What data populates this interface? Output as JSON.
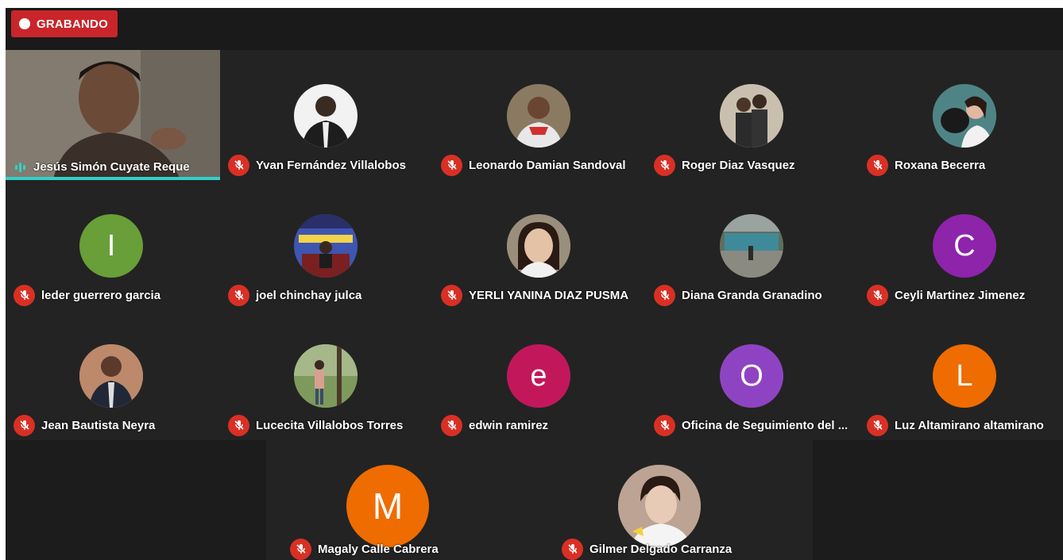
{
  "recording": {
    "label": "GRABANDO",
    "color": "#c9252b"
  },
  "colors": {
    "mic_muted": "#d93025",
    "active_speaker": "#33d0c8"
  },
  "active_speaker": {
    "name": "Jesús Simón Cuyate Reque"
  },
  "participants": [
    {
      "name": "Yvan Fernández Villalobos",
      "avatar": "photo"
    },
    {
      "name": "Leonardo Damian Sandoval",
      "avatar": "photo"
    },
    {
      "name": "Roger Diaz Vasquez",
      "avatar": "photo"
    },
    {
      "name": "Roxana Becerra",
      "avatar": "photo"
    },
    {
      "name": "leder guerrero garcia",
      "initial": "I",
      "color": "#689f38"
    },
    {
      "name": "joel chinchay julca",
      "avatar": "photo"
    },
    {
      "name": "YERLI YANINA DIAZ PUSMA",
      "avatar": "photo"
    },
    {
      "name": "Diana Granda Granadino",
      "avatar": "photo"
    },
    {
      "name": "Ceyli Martinez Jimenez",
      "initial": "C",
      "color": "#8e24aa"
    },
    {
      "name": "Jean Bautista Neyra",
      "avatar": "photo"
    },
    {
      "name": "Lucecita Villalobos Torres",
      "avatar": "photo"
    },
    {
      "name": "edwin ramirez",
      "initial": "e",
      "color": "#c2185b"
    },
    {
      "name": "Oficina de Seguimiento del ...",
      "initial": "O",
      "color": "#8e44c2"
    },
    {
      "name": "Luz Altamirano altamirano",
      "initial": "L",
      "color": "#ef6c00"
    },
    {
      "name": "Magaly Calle Cabrera",
      "initial": "M",
      "color": "#ef6c00"
    },
    {
      "name": "Gilmer Delgado Carranza",
      "avatar": "photo"
    }
  ]
}
